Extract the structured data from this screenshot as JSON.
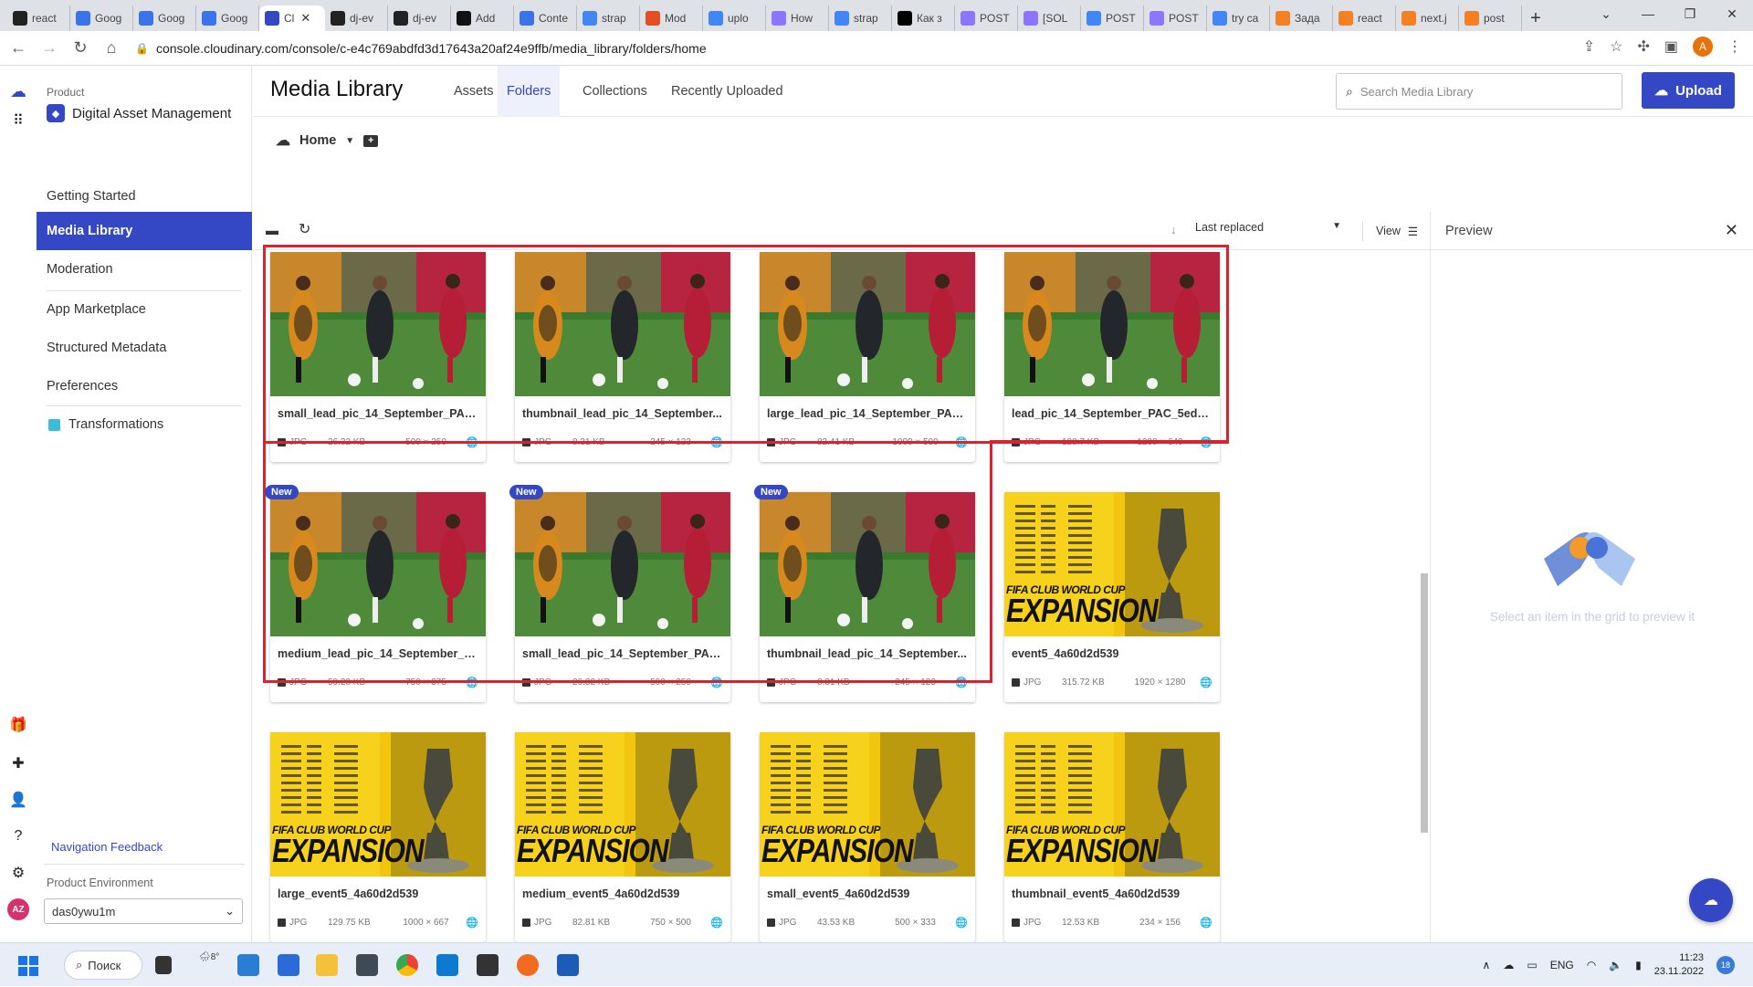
{
  "browser": {
    "tabs": [
      {
        "label": "react",
        "icon": "github-icon",
        "color": "#222"
      },
      {
        "label": "Goog",
        "icon": "google-docs-icon",
        "color": "#3b73e8"
      },
      {
        "label": "Goog",
        "icon": "google-docs-icon",
        "color": "#3b73e8"
      },
      {
        "label": "Goog",
        "icon": "google-docs-icon",
        "color": "#3b73e8"
      },
      {
        "label": "Cl",
        "icon": "cloudinary-icon",
        "color": "#3448c5",
        "active": true
      },
      {
        "label": "dj-ev",
        "icon": "github-icon",
        "color": "#222"
      },
      {
        "label": "dj-ev",
        "icon": "github-icon",
        "color": "#222"
      },
      {
        "label": "Add",
        "icon": "addon-icon",
        "color": "#111"
      },
      {
        "label": "Conte",
        "icon": "google-docs-icon",
        "color": "#3b73e8"
      },
      {
        "label": "strap",
        "icon": "google-icon",
        "color": "#4285f4"
      },
      {
        "label": "Mod",
        "icon": "code-icon",
        "color": "#e44d26"
      },
      {
        "label": "uplo",
        "icon": "google-icon",
        "color": "#4285f4"
      },
      {
        "label": "How",
        "icon": "strapi-icon",
        "color": "#8e75ff"
      },
      {
        "label": "strap",
        "icon": "google-icon",
        "color": "#4285f4"
      },
      {
        "label": "Как з",
        "icon": "dev-icon",
        "color": "#000"
      },
      {
        "label": "POST",
        "icon": "strapi-icon",
        "color": "#8e75ff"
      },
      {
        "label": "[SOL",
        "icon": "strapi-icon",
        "color": "#8e75ff"
      },
      {
        "label": "POST",
        "icon": "google-icon",
        "color": "#4285f4"
      },
      {
        "label": "POST",
        "icon": "strapi-icon",
        "color": "#8e75ff"
      },
      {
        "label": "try ca",
        "icon": "google-icon",
        "color": "#4285f4"
      },
      {
        "label": "Зада",
        "icon": "stackoverflow-icon",
        "color": "#f48024"
      },
      {
        "label": "react",
        "icon": "stackoverflow-icon",
        "color": "#f48024"
      },
      {
        "label": "next.j",
        "icon": "stackoverflow-icon",
        "color": "#f48024"
      },
      {
        "label": "post",
        "icon": "stackoverflow-icon",
        "color": "#f48024"
      }
    ],
    "url": "console.cloudinary.com/console/c-e4c769abdfd3d17643a20af24e9ffb/media_library/folders/home",
    "profile_initial": "A"
  },
  "sidebar": {
    "product_label": "Product",
    "product_name": "Digital Asset Management",
    "items": [
      {
        "label": "Getting Started"
      },
      {
        "label": "Media Library",
        "active": true
      },
      {
        "label": "Moderation"
      },
      {
        "label": "App Marketplace"
      },
      {
        "label": "Structured Metadata"
      },
      {
        "label": "Preferences"
      },
      {
        "label": "Transformations"
      }
    ],
    "nav_feedback": "Navigation Feedback",
    "env_label": "Product Environment",
    "env_value": "das0ywu1m",
    "avatar_initials": "AZ"
  },
  "header": {
    "title": "Media Library",
    "tabs": [
      "Assets",
      "Folders",
      "Collections",
      "Recently Uploaded"
    ],
    "active_tab": "Folders",
    "search_placeholder": "Search Media Library",
    "upload_label": "Upload"
  },
  "breadcrumb": {
    "label": "Home"
  },
  "toolbar": {
    "sort_label": "Last replaced",
    "view_label": "View"
  },
  "assets": [
    {
      "name": "small_lead_pic_14_September_PAC...",
      "format": "JPG",
      "size": "26.32 KB",
      "dims": "500 × 250",
      "kind": "football",
      "new": false
    },
    {
      "name": "thumbnail_lead_pic_14_September...",
      "format": "JPG",
      "size": "8.31 KB",
      "dims": "245 × 123",
      "kind": "football",
      "new": false
    },
    {
      "name": "large_lead_pic_14_September_PAC_...",
      "format": "JPG",
      "size": "82.41 KB",
      "dims": "1000 × 500",
      "kind": "football",
      "new": false
    },
    {
      "name": "lead_pic_14_September_PAC_5ed9...",
      "format": "JPG",
      "size": "128.7 KB",
      "dims": "1280 × 640",
      "kind": "football",
      "new": false
    },
    {
      "name": "medium_lead_pic_14_September_P...",
      "format": "JPG",
      "size": "50.28 KB",
      "dims": "750 × 375",
      "kind": "football",
      "new": true
    },
    {
      "name": "small_lead_pic_14_September_PAC...",
      "format": "JPG",
      "size": "26.32 KB",
      "dims": "500 × 250",
      "kind": "football",
      "new": true
    },
    {
      "name": "thumbnail_lead_pic_14_September...",
      "format": "JPG",
      "size": "8.31 KB",
      "dims": "245 × 123",
      "kind": "football",
      "new": true
    },
    {
      "name": "event5_4a60d2d539",
      "format": "JPG",
      "size": "315.72 KB",
      "dims": "1920 × 1280",
      "kind": "fifa",
      "new": false
    },
    {
      "name": "large_event5_4a60d2d539",
      "format": "JPG",
      "size": "129.75 KB",
      "dims": "1000 × 667",
      "kind": "fifa",
      "new": false
    },
    {
      "name": "medium_event5_4a60d2d539",
      "format": "JPG",
      "size": "82.81 KB",
      "dims": "750 × 500",
      "kind": "fifa",
      "new": false
    },
    {
      "name": "small_event5_4a60d2d539",
      "format": "JPG",
      "size": "43.53 KB",
      "dims": "500 × 333",
      "kind": "fifa",
      "new": false
    },
    {
      "name": "thumbnail_event5_4a60d2d539",
      "format": "JPG",
      "size": "12.53 KB",
      "dims": "234 × 156",
      "kind": "fifa",
      "new": false
    }
  ],
  "new_badge": "New",
  "fifa_text": {
    "line1": "FIFA CLUB WORLD CUP",
    "line2": "EXPANSION"
  },
  "preview": {
    "title": "Preview",
    "empty_text": "Select an item in the grid to preview it"
  },
  "taskbar": {
    "search_label": "Поиск",
    "weather": "8°",
    "lang": "ENG",
    "time": "11:23",
    "date": "23.11.2022",
    "notifications": "18"
  },
  "colors": {
    "accent": "#3448c5",
    "annotation": "#d9232f"
  }
}
